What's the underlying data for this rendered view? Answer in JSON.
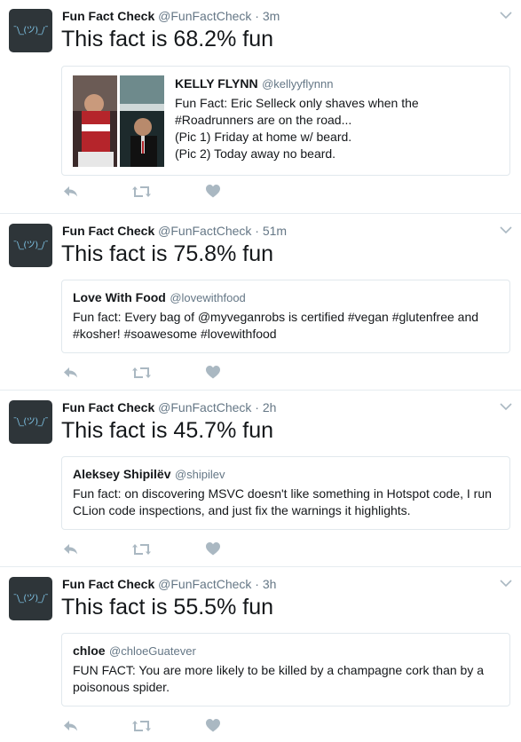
{
  "tweets": [
    {
      "author": "Fun Fact Check",
      "handle": "@FunFactCheck",
      "dot": "·",
      "time": "3m",
      "avatar_text": "¯\\_(ツ)_/¯",
      "fact": "This fact is 68.2% fun",
      "quote": {
        "name": "KELLY FLYNN",
        "handle": "@kellyyflynnn",
        "text": "Fun Fact: Eric Selleck only shaves when the\n#Roadrunners are on the road...\n(Pic 1) Friday at home w/ beard.\n(Pic 2) Today away no beard."
      }
    },
    {
      "author": "Fun Fact Check",
      "handle": "@FunFactCheck",
      "dot": "·",
      "time": "51m",
      "avatar_text": "¯\\_(ツ)_/¯",
      "fact": "This fact is 75.8% fun",
      "quote": {
        "name": "Love With Food",
        "handle": "@lovewithfood",
        "text": "Fun fact: Every bag of @myveganrobs is certified #vegan #glutenfree and\n#kosher! #soawesome #lovewithfood"
      }
    },
    {
      "author": "Fun Fact Check",
      "handle": "@FunFactCheck",
      "dot": "·",
      "time": "2h",
      "avatar_text": "¯\\_(ツ)_/¯",
      "fact": "This fact is 45.7% fun",
      "quote": {
        "name": "Aleksey Shipilёv",
        "handle": "@shipilev",
        "text": "Fun fact: on discovering MSVC doesn't like something in Hotspot code, I run\nCLion code inspections, and just fix the warnings it highlights."
      }
    },
    {
      "author": "Fun Fact Check",
      "handle": "@FunFactCheck",
      "dot": "·",
      "time": "3h",
      "avatar_text": "¯\\_(ツ)_/¯",
      "fact": "This fact is 55.5% fun",
      "quote": {
        "name": "chloe",
        "handle": "@chloeGuatever",
        "text": "FUN FACT: You are more likely to be killed by a champagne cork than by a\npoisonous spider."
      }
    }
  ],
  "icons": {
    "reply": "reply-icon",
    "retweet": "retweet-icon",
    "like": "heart-icon",
    "more": "chevron-down-icon"
  },
  "colors": {
    "icon_gray": "#aab8c2",
    "text_secondary": "#657786",
    "divider": "#e6ecf0",
    "avatar_bg": "#2e3539",
    "avatar_fg": "#7fc4e6"
  }
}
